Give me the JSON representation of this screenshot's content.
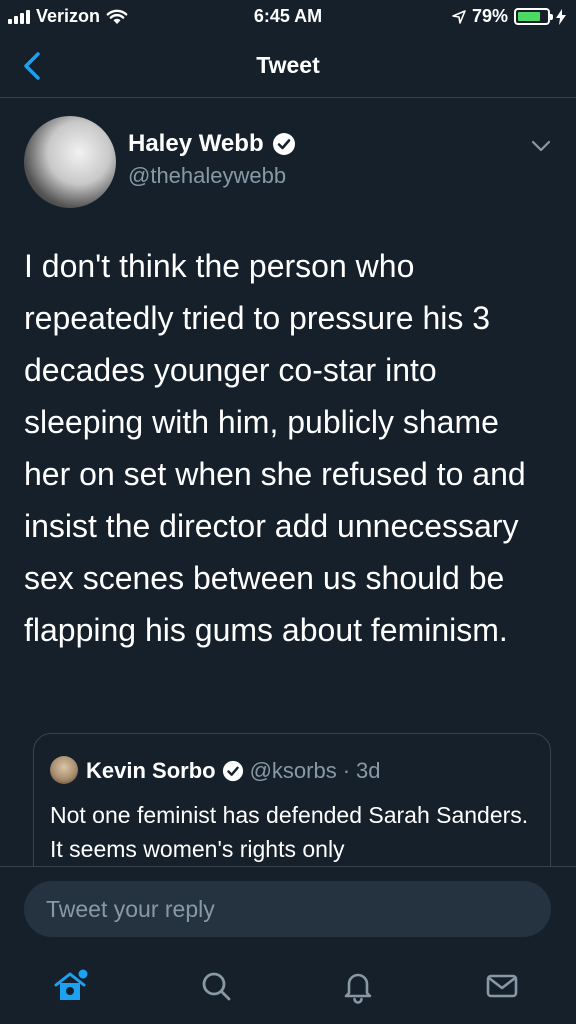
{
  "status_bar": {
    "carrier": "Verizon",
    "time": "6:45 AM",
    "battery": "79%",
    "battery_level": 0.79
  },
  "header": {
    "title": "Tweet"
  },
  "tweet": {
    "author_name": "Haley Webb",
    "author_handle": "@thehaleywebb",
    "text": "I don't think the person who repeatedly tried to pressure his 3 decades younger co-star into sleeping with him, publicly shame her on set when she refused to and insist the director add unnecessary sex scenes between us should be flapping his gums about feminism."
  },
  "quoted_tweet": {
    "author_name": "Kevin Sorbo",
    "author_handle": "@ksorbs",
    "separator": "·",
    "time": "3d",
    "text": "Not one feminist has defended Sarah Sanders.  It seems women's rights only"
  },
  "reply": {
    "placeholder": "Tweet your reply"
  },
  "colors": {
    "background": "#15202b",
    "accent": "#1da1f2",
    "secondary_text": "#8899a6",
    "border": "#38444d"
  },
  "tabs": [
    "home-icon",
    "search-icon",
    "notifications-icon",
    "messages-icon"
  ]
}
